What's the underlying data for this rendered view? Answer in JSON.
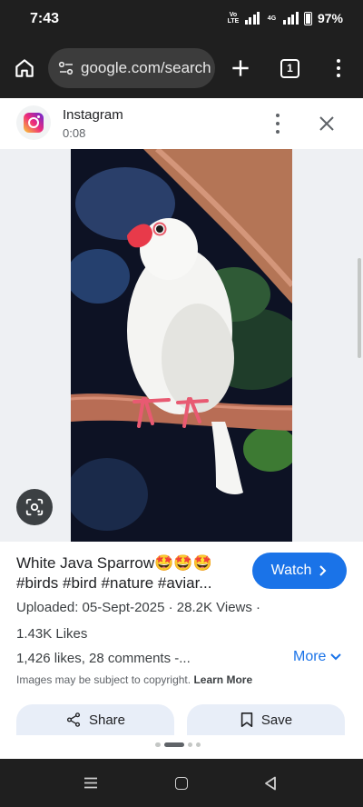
{
  "status_bar": {
    "time": "7:43",
    "network_label": "Vo LTE",
    "network_label_2": "4G",
    "battery": "97%"
  },
  "browser": {
    "url": "google.com/search",
    "tab_count": "1"
  },
  "source": {
    "name": "Instagram",
    "duration": "0:08"
  },
  "result": {
    "title_line1": "White Java Sparrow🤩🤩🤩",
    "title_line2": "#birds #bird #nature #aviar...",
    "watch_label": "Watch",
    "uploaded": "Uploaded: 05-Sept-2025 · 28.2K Views ·",
    "likes": "1.43K Likes",
    "likes_comments": "1,426 likes, 28 comments -...",
    "more_label": "More",
    "copyright_text": "Images may be subject to copyright.",
    "learn_more": "Learn More",
    "share_label": "Share",
    "save_label": "Save",
    "pager": {
      "count": 4,
      "active": 1
    }
  },
  "colors": {
    "accent": "#1a73e8",
    "chrome_dark": "#1f1f1f",
    "action_bg": "#e8eef8"
  },
  "icons": [
    "home-icon",
    "tune-icon",
    "plus-icon",
    "tab-switcher-icon",
    "more-vert-icon",
    "instagram-logo",
    "close-icon",
    "google-lens-icon",
    "chevron-right-icon",
    "chevron-down-icon",
    "share-icon",
    "bookmark-icon",
    "recents-icon",
    "nav-home-icon",
    "back-icon"
  ]
}
